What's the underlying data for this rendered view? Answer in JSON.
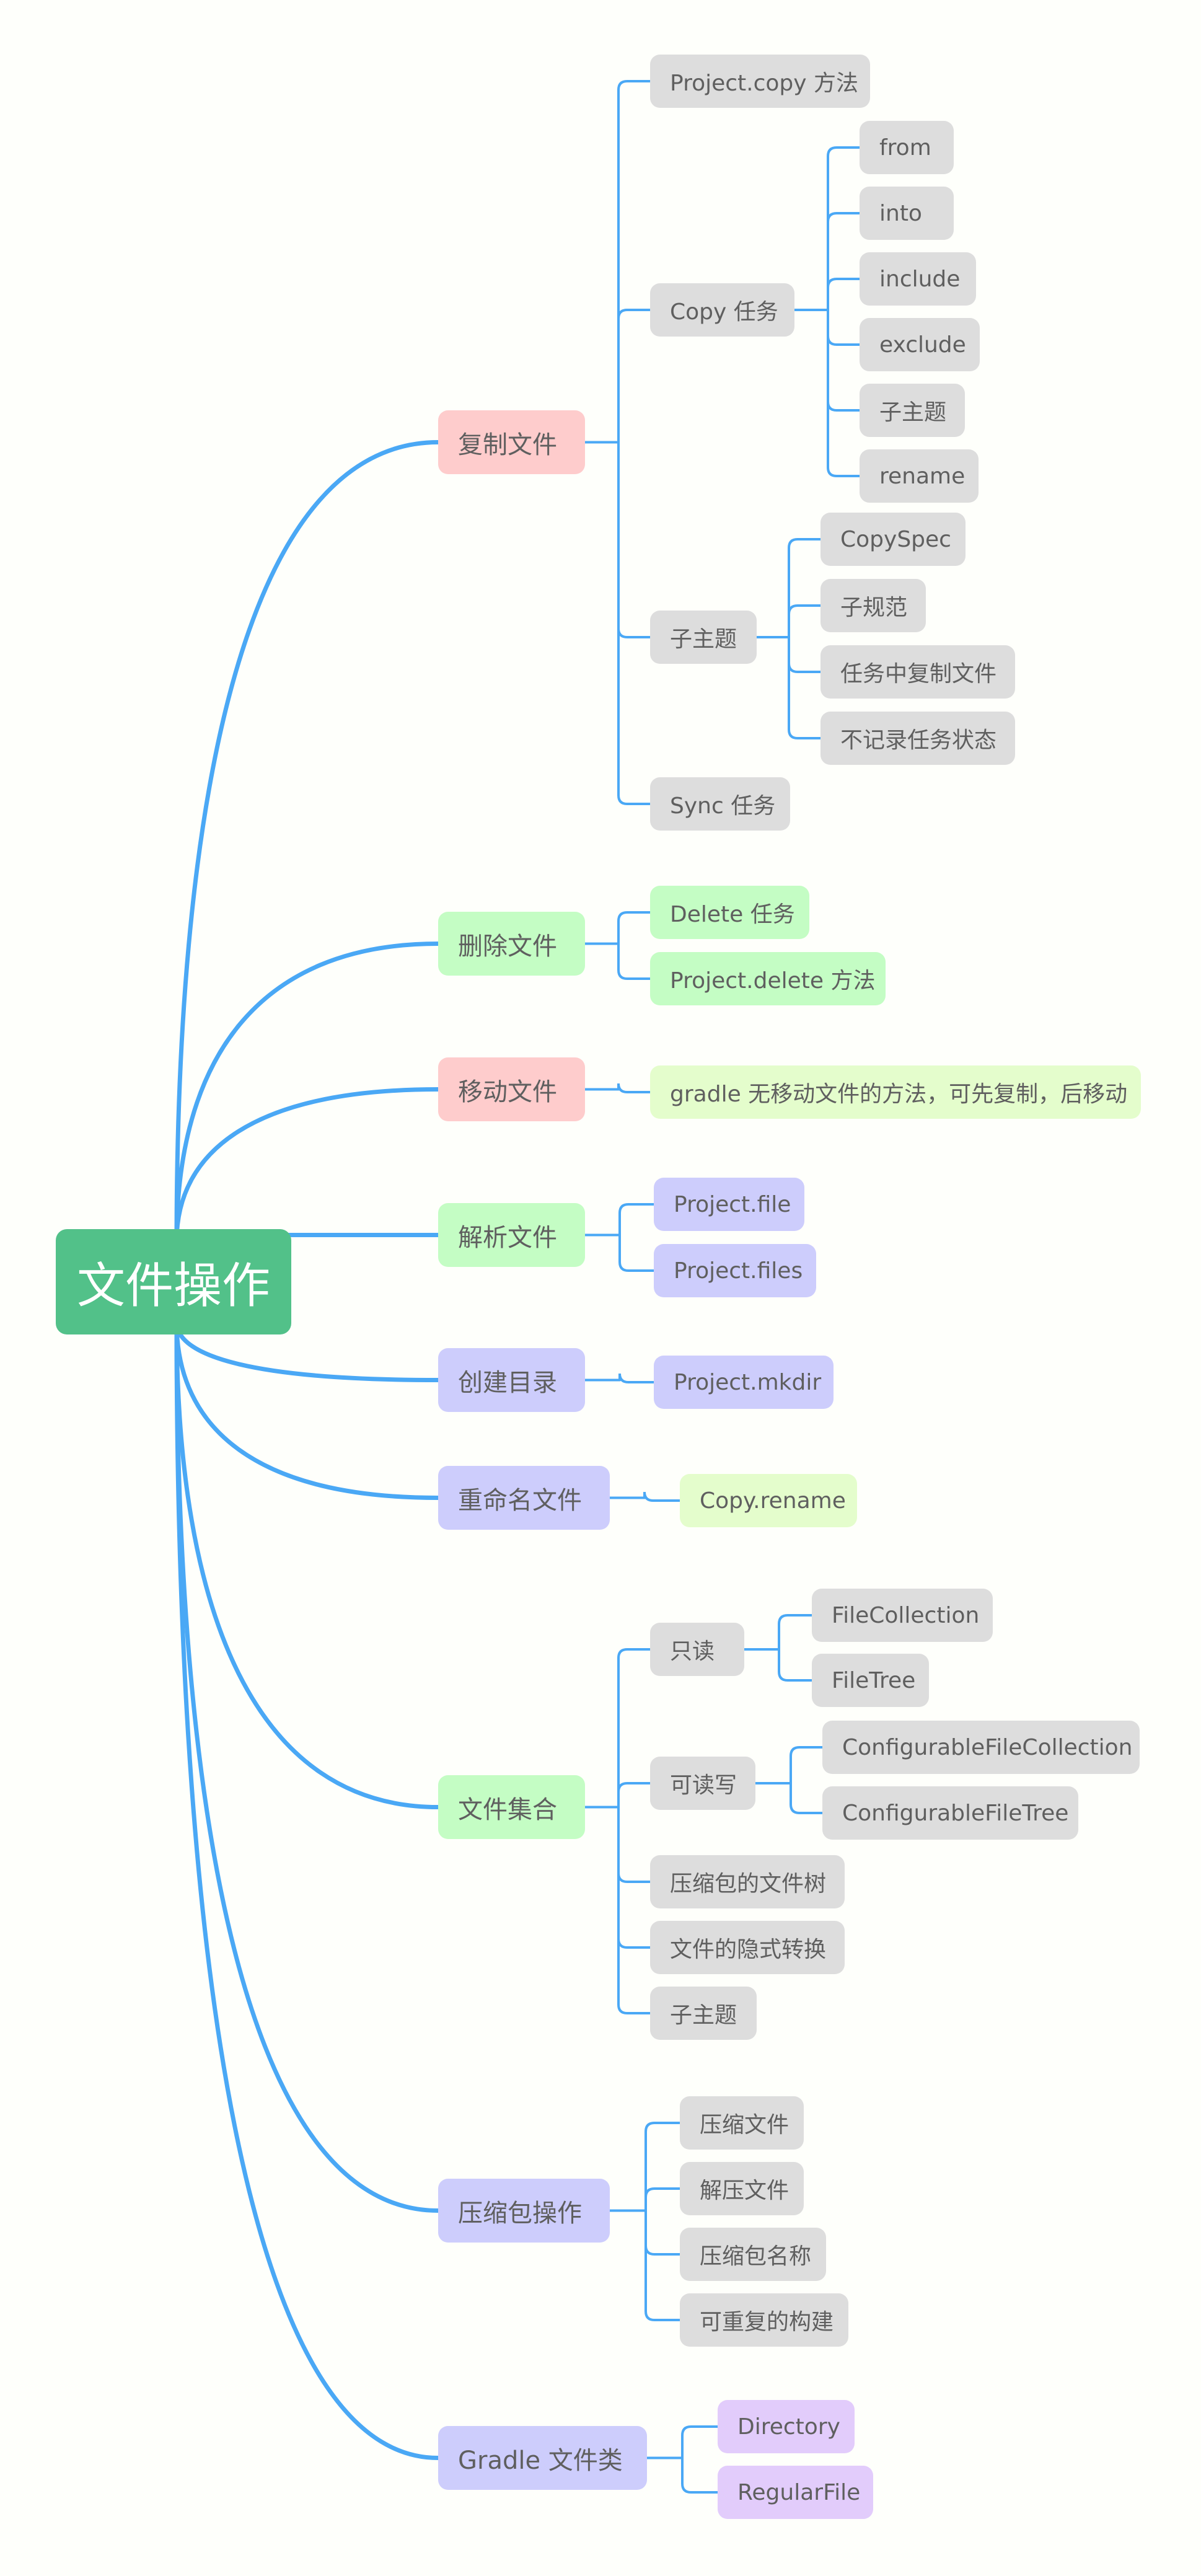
{
  "root": {
    "label": "文件操作"
  },
  "colors": {
    "root": "#52c189",
    "connector": "#4aa8f5",
    "pink": "#fecccc",
    "green": "#c4fdc4",
    "lavender": "#cdcdfc",
    "lime": "#e4fdcc",
    "gray": "#dddddd",
    "purple": "#e2ccfb",
    "text": "#5f5f5f"
  },
  "branches": [
    {
      "label": "复制文件",
      "children": [
        {
          "label": "Project.copy 方法"
        },
        {
          "label": "Copy 任务",
          "children": [
            {
              "label": "from"
            },
            {
              "label": "into"
            },
            {
              "label": "include"
            },
            {
              "label": "exclude"
            },
            {
              "label": "子主题"
            },
            {
              "label": "rename"
            }
          ]
        },
        {
          "label": "子主题",
          "children": [
            {
              "label": "CopySpec"
            },
            {
              "label": "子规范"
            },
            {
              "label": "任务中复制文件"
            },
            {
              "label": "不记录任务状态"
            }
          ]
        },
        {
          "label": "Sync 任务"
        }
      ]
    },
    {
      "label": "删除文件",
      "children": [
        {
          "label": "Delete 任务"
        },
        {
          "label": "Project.delete 方法"
        }
      ]
    },
    {
      "label": "移动文件",
      "children": [
        {
          "label": "gradle 无移动文件的方法，可先复制，后移动"
        }
      ]
    },
    {
      "label": "解析文件",
      "children": [
        {
          "label": "Project.file"
        },
        {
          "label": "Project.files"
        }
      ]
    },
    {
      "label": "创建目录",
      "children": [
        {
          "label": "Project.mkdir"
        }
      ]
    },
    {
      "label": "重命名文件",
      "children": [
        {
          "label": "Copy.rename"
        }
      ]
    },
    {
      "label": "文件集合",
      "children": [
        {
          "label": "只读",
          "children": [
            {
              "label": "FileCollection"
            },
            {
              "label": "FileTree"
            }
          ]
        },
        {
          "label": "可读写",
          "children": [
            {
              "label": "ConfigurableFileCollection"
            },
            {
              "label": "ConfigurableFileTree"
            }
          ]
        },
        {
          "label": "压缩包的文件树"
        },
        {
          "label": "文件的隐式转换"
        },
        {
          "label": "子主题"
        }
      ]
    },
    {
      "label": "压缩包操作",
      "children": [
        {
          "label": "压缩文件"
        },
        {
          "label": "解压文件"
        },
        {
          "label": "压缩包名称"
        },
        {
          "label": "可重复的构建"
        }
      ]
    },
    {
      "label": "Gradle 文件类",
      "children": [
        {
          "label": "Directory"
        },
        {
          "label": "RegularFile"
        }
      ]
    }
  ]
}
